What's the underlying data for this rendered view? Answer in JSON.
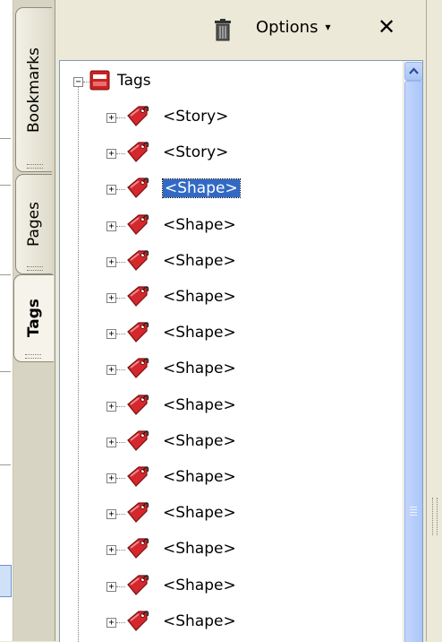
{
  "tabs": [
    {
      "id": "bookmarks",
      "label": "Bookmarks"
    },
    {
      "id": "pages",
      "label": "Pages"
    },
    {
      "id": "tags",
      "label": "Tags",
      "active": true
    }
  ],
  "toolbar": {
    "options_label": "Options",
    "options_caret": "▾",
    "close_label": "✕"
  },
  "tree": {
    "root": {
      "label": "Tags",
      "expanded": true
    },
    "children": [
      {
        "label": "<Story>"
      },
      {
        "label": "<Story>"
      },
      {
        "label": "<Shape>",
        "selected": true
      },
      {
        "label": "<Shape>"
      },
      {
        "label": "<Shape>"
      },
      {
        "label": "<Shape>"
      },
      {
        "label": "<Shape>"
      },
      {
        "label": "<Shape>"
      },
      {
        "label": "<Shape>"
      },
      {
        "label": "<Shape>"
      },
      {
        "label": "<Shape>"
      },
      {
        "label": "<Shape>"
      },
      {
        "label": "<Shape>"
      },
      {
        "label": "<Shape>"
      },
      {
        "label": "<Shape>"
      }
    ]
  },
  "colors": {
    "selection": "#316ac5",
    "tag_icon": "#d4282e",
    "root_icon": "#cc2222"
  },
  "icons": {
    "trash": "trash-icon",
    "tag": "tag-icon",
    "root": "tag-root-icon",
    "close": "close-icon"
  }
}
